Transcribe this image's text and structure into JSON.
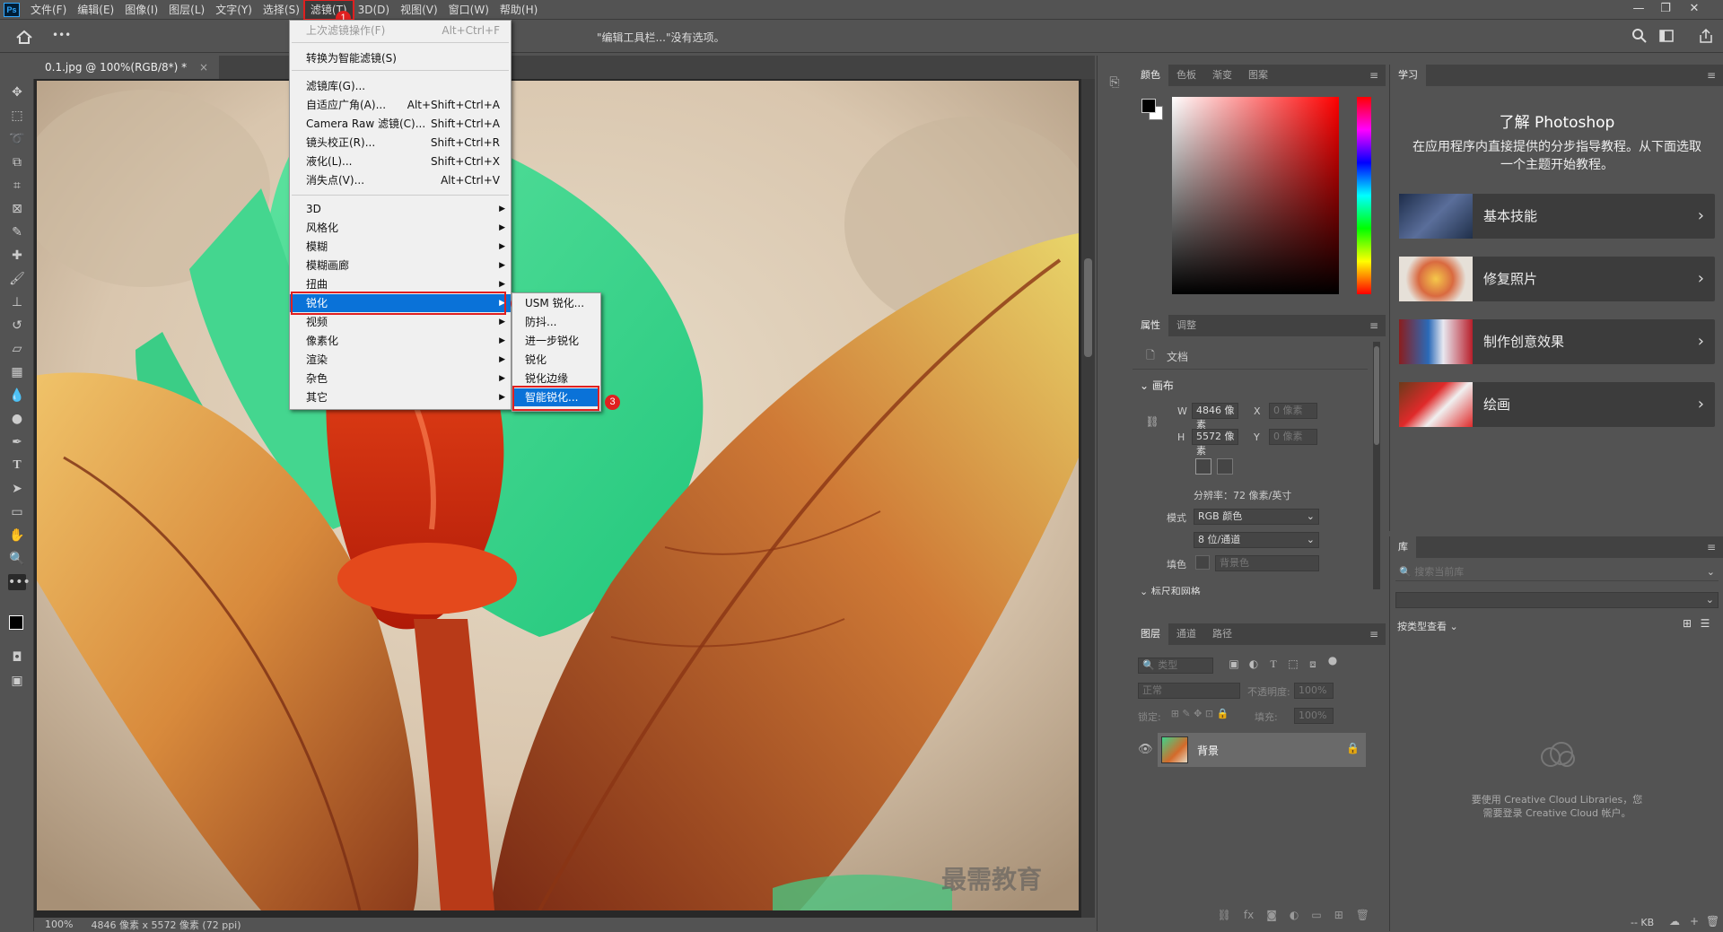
{
  "menubar": {
    "logo": "Ps",
    "items": [
      "文件(F)",
      "编辑(E)",
      "图像(I)",
      "图层(L)",
      "文字(Y)",
      "选择(S)",
      "滤镜(T)",
      "3D(D)",
      "视图(V)",
      "窗口(W)",
      "帮助(H)"
    ]
  },
  "window_controls": {
    "minimize": "—",
    "restore": "❐",
    "close": "✕"
  },
  "options_bar": {
    "message": "\"编辑工具栏...\"没有选项。",
    "home_icon": "home-icon",
    "more_label": "•••"
  },
  "doc_tab": {
    "title": "0.1.jpg @ 100%(RGB/8*) *",
    "close": "×"
  },
  "filter_menu": {
    "items": [
      {
        "label": "上次滤镜操作(F)",
        "shortcut": "Alt+Ctrl+F",
        "disabled": true
      },
      {
        "label": "转换为智能滤镜(S)",
        "shortcut": ""
      },
      {
        "label": "滤镜库(G)...",
        "shortcut": ""
      },
      {
        "label": "自适应广角(A)...",
        "shortcut": "Alt+Shift+Ctrl+A"
      },
      {
        "label": "Camera Raw 滤镜(C)...",
        "shortcut": "Shift+Ctrl+A"
      },
      {
        "label": "镜头校正(R)...",
        "shortcut": "Shift+Ctrl+R"
      },
      {
        "label": "液化(L)...",
        "shortcut": "Shift+Ctrl+X"
      },
      {
        "label": "消失点(V)...",
        "shortcut": "Alt+Ctrl+V"
      },
      {
        "label": "3D",
        "shortcut": ""
      },
      {
        "label": "风格化",
        "shortcut": ""
      },
      {
        "label": "模糊",
        "shortcut": ""
      },
      {
        "label": "模糊画廊",
        "shortcut": ""
      },
      {
        "label": "扭曲",
        "shortcut": ""
      },
      {
        "label": "锐化",
        "shortcut": ""
      },
      {
        "label": "视频",
        "shortcut": ""
      },
      {
        "label": "像素化",
        "shortcut": ""
      },
      {
        "label": "渲染",
        "shortcut": ""
      },
      {
        "label": "杂色",
        "shortcut": ""
      },
      {
        "label": "其它",
        "shortcut": ""
      }
    ]
  },
  "sharpen_submenu": {
    "items": [
      "USM 锐化...",
      "防抖...",
      "进一步锐化",
      "锐化",
      "锐化边缘",
      "智能锐化..."
    ]
  },
  "step_badges": [
    "1",
    "2",
    "3"
  ],
  "color_panel": {
    "tabs": [
      "颜色",
      "色板",
      "渐变",
      "图案"
    ]
  },
  "properties_panel": {
    "tabs": [
      "属性",
      "调整"
    ],
    "doc_label": "文档",
    "section": "画布",
    "w_label": "W",
    "w_value": "4846 像素",
    "h_label": "H",
    "h_value": "5572 像素",
    "x_label": "X",
    "x_placeholder": "0 像素",
    "y_label": "Y",
    "y_placeholder": "0 像素",
    "resolution": "分辨率：72 像素/英寸",
    "mode_label": "模式",
    "mode_value": "RGB 颜色",
    "depth_value": "8 位/通道",
    "fill_label": "填色",
    "fill_value": "背景色",
    "next_section": "标尺和网格"
  },
  "layers_panel": {
    "tabs": [
      "图层",
      "通道",
      "路径"
    ],
    "filter_placeholder": "类型",
    "blend_mode": "正常",
    "opacity_label": "不透明度:",
    "opacity_value": "100%",
    "lock_label": "锁定:",
    "fill_label": "填充:",
    "fill_value": "100%",
    "layer_name": "背景"
  },
  "learn_panel": {
    "tab": "学习",
    "title": "了解 Photoshop",
    "subtitle": "在应用程序内直接提供的分步指导教程。从下面选取一个主题开始教程。",
    "cards": [
      "基本技能",
      "修复照片",
      "制作创意效果",
      "绘画"
    ]
  },
  "library_panel": {
    "tab": "库",
    "search_placeholder": "搜索当前库",
    "view_label": "按类型查看",
    "message_line1": "要使用 Creative Cloud Libraries，您",
    "message_line2": "需要登录 Creative Cloud 帐户。",
    "kb_label": "-- KB"
  },
  "status_bar": {
    "zoom": "100%",
    "doc_info": "4846 像素 x 5572 像素 (72 ppi)"
  },
  "watermark": "最需教育",
  "colors": {
    "accent": "#0a72d8",
    "highlight_box": "#e02020",
    "ui_bg": "#535353",
    "canvas_bg": "#282828"
  }
}
